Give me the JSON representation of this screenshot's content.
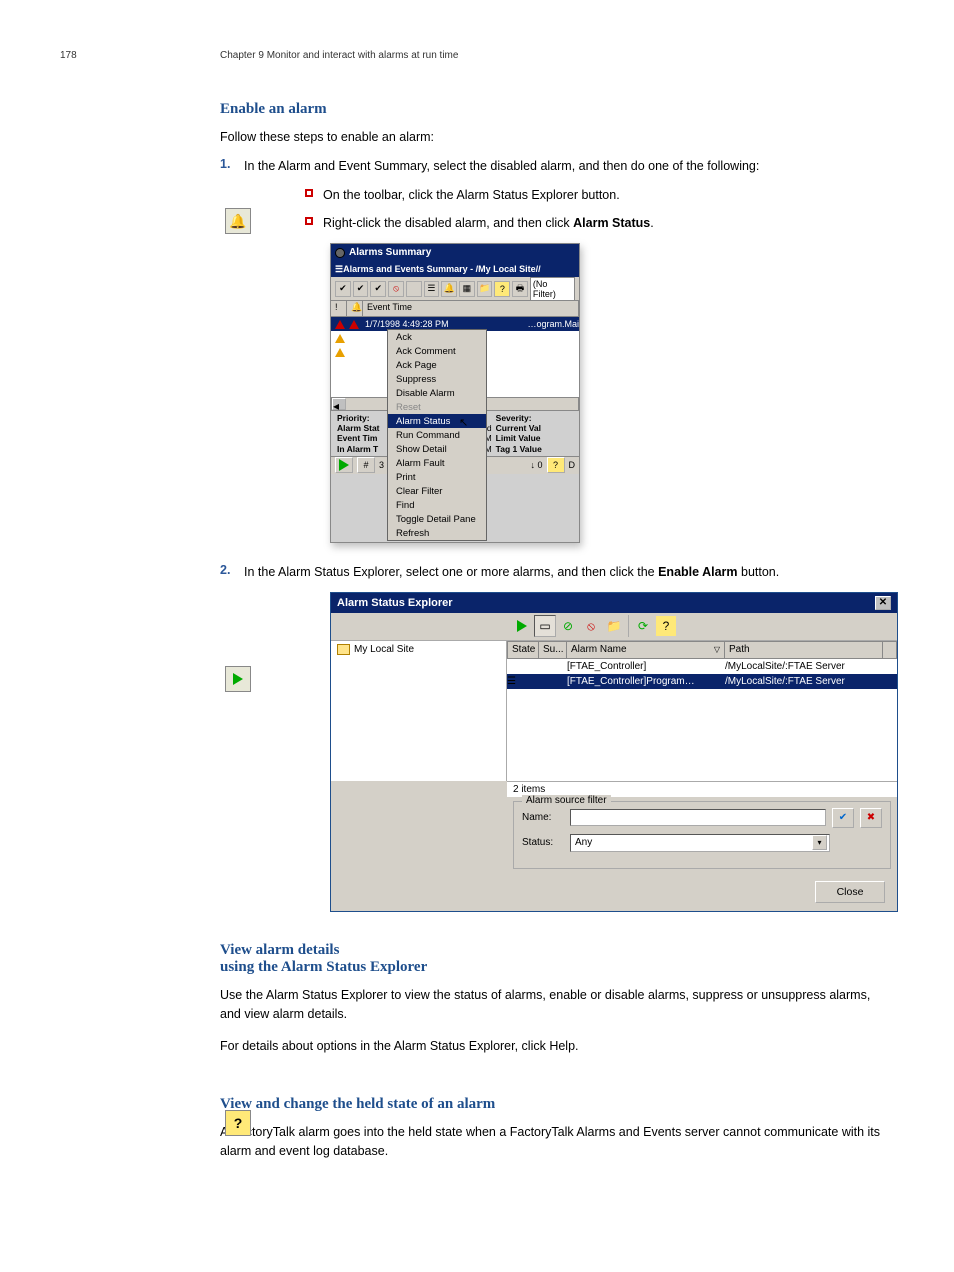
{
  "header": {
    "page_number": "178",
    "chapter_line": "Chapter 9  Monitor and interact with alarms at run time"
  },
  "sections": {
    "enable_heading": "Enable an alarm",
    "status_heading": "View alarm details",
    "status_heading_extra": "using the Alarm Status Explorer",
    "held_heading": "View and change the held state of an alarm",
    "intro_enable": "Follow these steps to enable an alarm:",
    "step1a": "In the Alarm and Event Summary, select the disabled alarm, and then do one of the following:",
    "bullet1": "On the toolbar, click the Alarm Status Explorer button.",
    "bullet2a": "Right-click the disabled alarm, and then click ",
    "bullet2b": "Alarm Status",
    "bullet2c": ".",
    "step2a": "In the Alarm Status Explorer, select one or more alarms, and then click the ",
    "step2b": "Enable Alarm",
    "step2c": " button.",
    "para1": "Use the Alarm Status Explorer to view the status of alarms, enable or disable alarms, suppress or unsuppress alarms, and view alarm details.",
    "para2": "For details about options in the Alarm Status Explorer, click Help.",
    "held_para": "A FactoryTalk alarm goes into the held state when a FactoryTalk Alarms and Events server cannot communicate with its alarm and event log database."
  },
  "shot1": {
    "title1": "Alarms Summary",
    "title2": "Alarms and Events Summary - /My Local Site//",
    "filter_label": "(No Filter)",
    "col_event": "Event Time",
    "row1_time": "1/7/1998 4:49:28 PM",
    "row1_right": "…ogram.Mai",
    "priority_label": "Priority:",
    "alarm_state_label": "Alarm Stat",
    "event_time_label": "Event Tim",
    "in_alarm_label": "In Alarm T",
    "severity_label": "Severity:",
    "current_val_label": "Current Val",
    "limit_val_label": "Limit Value",
    "tag1_val_label": "Tag 1 Value",
    "time_28pm_1": ":28 PM",
    "time_28pm_2": ":28 PM",
    "status_marker": "ked",
    "count": "3",
    "zero": "0",
    "zerod": "D",
    "hash": "#",
    "cm": {
      "ack": "Ack",
      "ack_comment": "Ack Comment",
      "ack_page": "Ack Page",
      "suppress": "Suppress",
      "disable_alarm": "Disable Alarm",
      "reset": "Reset",
      "alarm_status": "Alarm Status",
      "run_command": "Run Command",
      "show_detail": "Show Detail",
      "alarm_fault": "Alarm Fault",
      "print": "Print",
      "clear_filter": "Clear Filter",
      "find": "Find",
      "toggle_detail": "Toggle Detail Pane",
      "refresh": "Refresh"
    }
  },
  "shot2": {
    "title": "Alarm Status Explorer",
    "tree_root": "My Local Site",
    "col_state": "State",
    "col_su": "Su...",
    "col_alarm_name": "Alarm Name",
    "col_path": "Path",
    "r1_name": "[FTAE_Controller]",
    "r1_path": "/MyLocalSite/:FTAE Server",
    "r2_name": "[FTAE_Controller]Program…",
    "r2_path": "/MyLocalSite/:FTAE Server",
    "items_count": "2 items",
    "filter_legend": "Alarm source filter",
    "name_label": "Name:",
    "status_label": "Status:",
    "status_value": "Any",
    "close_btn": "Close"
  }
}
